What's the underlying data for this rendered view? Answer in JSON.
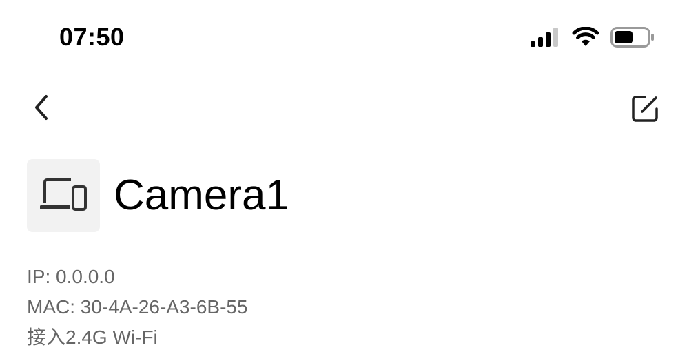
{
  "status_bar": {
    "time": "07:50",
    "icons": [
      "cellular-signal-icon",
      "wifi-icon",
      "battery-icon"
    ],
    "battery_level": 0.55
  },
  "nav": {
    "back_icon": "chevron-left-icon",
    "edit_icon": "edit-square-icon"
  },
  "device": {
    "icon": "devices-icon",
    "name": "Camera1"
  },
  "info": {
    "ip": "IP: 0.0.0.0",
    "mac": "MAC: 30-4A-26-A3-6B-55",
    "connection": "接入2.4G Wi-Fi"
  }
}
